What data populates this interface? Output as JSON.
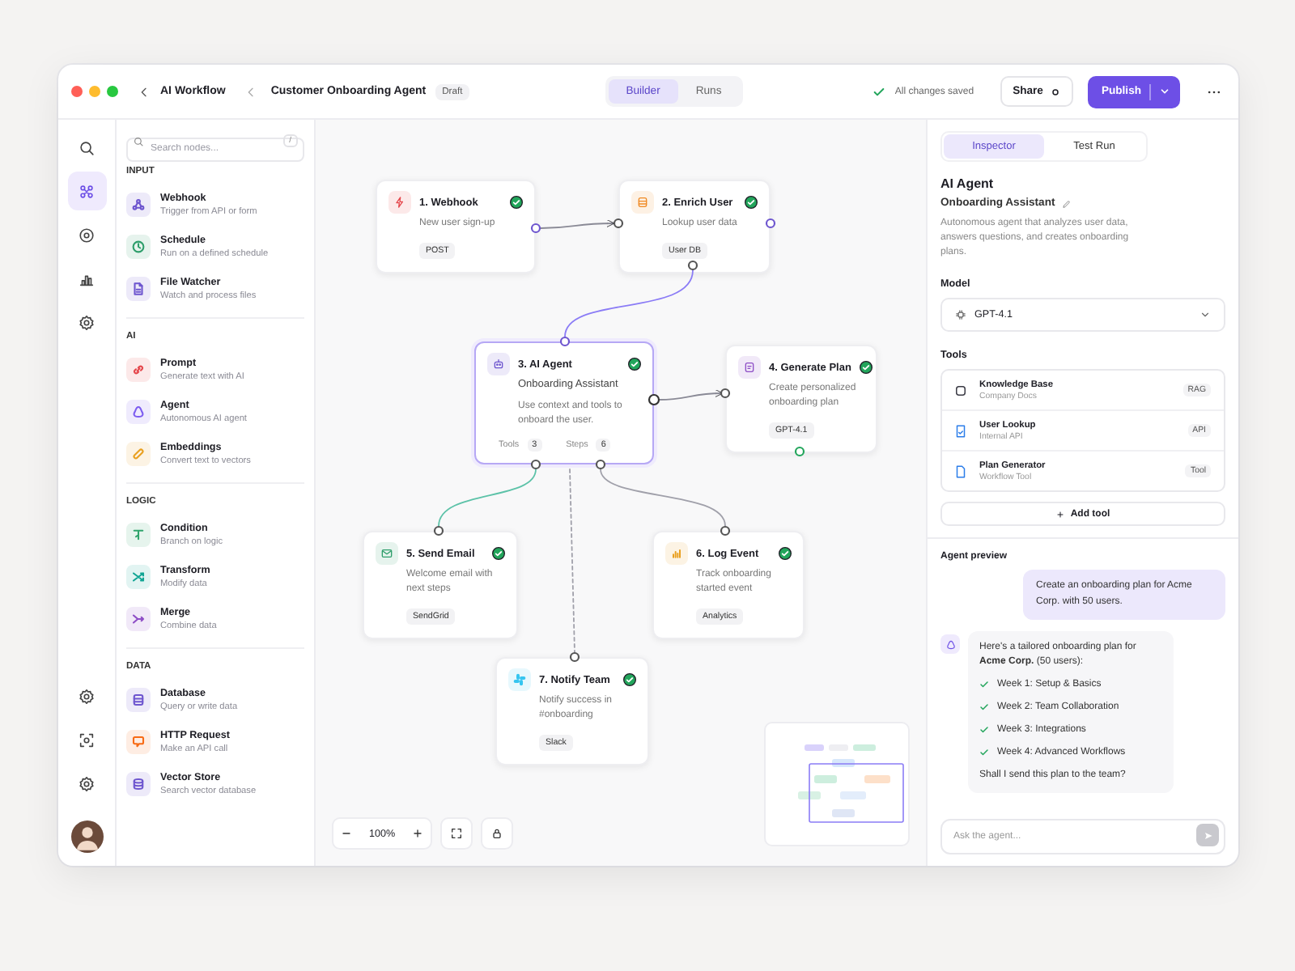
{
  "window": {
    "breadcrumb": "AI Workflow",
    "title": "Customer Onboarding Agent",
    "badge": "Draft"
  },
  "view_tabs": [
    {
      "label": "Builder",
      "selected": true
    },
    {
      "label": "Runs",
      "selected": false
    }
  ],
  "save_status": "All changes saved",
  "share_label": "Share",
  "publish_label": "Publish",
  "rail": {
    "top": [
      {
        "kind": "search",
        "selected": false
      },
      {
        "kind": "nodes",
        "selected": true
      },
      {
        "kind": "target",
        "selected": false
      },
      {
        "kind": "chart",
        "selected": false
      },
      {
        "kind": "gear",
        "selected": false
      }
    ],
    "bottom": [
      {
        "kind": "gear",
        "selected": false
      },
      {
        "kind": "scan",
        "selected": false
      },
      {
        "kind": "gear",
        "selected": false
      }
    ]
  },
  "node_panel": {
    "search_placeholder": "Search nodes...",
    "shortcut": "/",
    "sections": [
      {
        "title": "INPUT",
        "items": [
          {
            "name": "Webhook",
            "description": "Trigger from API or form",
            "kind": "webhook",
            "color": "#6e56cf"
          },
          {
            "name": "Schedule",
            "description": "Run on a defined schedule",
            "kind": "clock",
            "color": "#2f9e6b"
          },
          {
            "name": "File Watcher",
            "description": "Watch and process files",
            "kind": "file",
            "color": "#6e56cf"
          }
        ]
      },
      {
        "title": "AI",
        "items": [
          {
            "name": "Prompt",
            "description": "Generate text with AI",
            "kind": "link",
            "color": "#e5484d"
          },
          {
            "name": "Agent",
            "description": "Autonomous AI agent",
            "kind": "agent",
            "color": "#7c5cf0"
          },
          {
            "name": "Embeddings",
            "description": "Convert text to vectors",
            "kind": "capsule",
            "color": "#e9a020"
          }
        ]
      },
      {
        "title": "LOGIC",
        "items": [
          {
            "name": "Condition",
            "description": "Branch on logic",
            "kind": "condition",
            "color": "#30a46c"
          },
          {
            "name": "Transform",
            "description": "Modify data",
            "kind": "shuffle",
            "color": "#12a594"
          },
          {
            "name": "Merge",
            "description": "Combine data",
            "kind": "merge",
            "color": "#8e4ec6"
          }
        ]
      },
      {
        "title": "DATA",
        "items": [
          {
            "name": "Database",
            "description": "Query or write data",
            "kind": "database",
            "color": "#6e56cf"
          },
          {
            "name": "HTTP Request",
            "description": "Make an API call",
            "kind": "message",
            "color": "#f76b15"
          },
          {
            "name": "Vector Store",
            "description": "Search vector database",
            "kind": "layers",
            "color": "#6e56cf"
          }
        ]
      }
    ]
  },
  "canvas": {
    "nodes": [
      {
        "title": "1. Webhook",
        "description": "New user sign-up",
        "tag": "POST",
        "kind": "bolt",
        "color": "#e5484d",
        "done": true,
        "selected": false
      },
      {
        "title": "2. Enrich User",
        "description": "Lookup user data",
        "tag": "User DB",
        "kind": "database",
        "color": "#f08a24",
        "done": true,
        "selected": false
      },
      {
        "title": "3. AI Agent",
        "subtitle": "Onboarding Assistant",
        "description": "Use context and tools to onboard the user.",
        "stats": [
          {
            "label": "Tools",
            "value": "3"
          },
          {
            "label": "Steps",
            "value": "6"
          }
        ],
        "kind": "robot",
        "color": "#6e56cf",
        "done": true,
        "selected": true
      },
      {
        "title": "4. Generate Plan",
        "description": "Create personalized onboarding plan",
        "tag": "GPT-4.1",
        "kind": "plan",
        "color": "#8e4ec6",
        "done": true,
        "selected": false
      },
      {
        "title": "5. Send Email",
        "description": "Welcome email with next steps",
        "tag": "SendGrid",
        "kind": "mail",
        "color": "#2f9e6b",
        "done": true,
        "selected": false
      },
      {
        "title": "6. Log Event",
        "description": "Track onboarding started event",
        "tag": "Analytics",
        "kind": "bars",
        "color": "#e9a020",
        "done": true,
        "selected": false
      },
      {
        "title": "7. Notify Team",
        "description": "Notify success in #onboarding",
        "tag": "Slack",
        "kind": "slack",
        "color": "#36c5f0",
        "done": true,
        "selected": false
      }
    ],
    "zoom": "100%"
  },
  "inspector": {
    "tabs": [
      {
        "label": "Inspector",
        "selected": true
      },
      {
        "label": "Test Run",
        "selected": false
      }
    ],
    "heading": "AI Agent",
    "name": "Onboarding Assistant",
    "description": "Autonomous agent that analyzes user data, answers questions, and creates onboarding plans.",
    "model_label": "Model",
    "model": "GPT-4.1",
    "tools_label": "Tools",
    "tools": [
      {
        "name": "Knowledge Base",
        "description": "Company Docs",
        "badge": "RAG",
        "kind": "square",
        "color": "#3a3a44"
      },
      {
        "name": "User Lookup",
        "description": "Internal API",
        "badge": "API",
        "kind": "userdoc",
        "color": "#2b7de9"
      },
      {
        "name": "Plan Generator",
        "description": "Workflow Tool",
        "badge": "Tool",
        "kind": "doc",
        "color": "#2b7de9"
      }
    ],
    "add_tool": "Add tool",
    "preview_label": "Agent preview",
    "messages": [
      {
        "kind": "user",
        "text": "Create an onboarding plan for Acme Corp. with 50 users."
      },
      {
        "kind": "agent",
        "text": "Here's a tailored onboarding plan for **Acme Corp.** (50 users):",
        "steps": [
          "Week 1: Setup & Basics",
          "Week 2: Team Collaboration",
          "Week 3: Integrations",
          "Week 4: Advanced Workflows"
        ],
        "closing": "Shall I send this plan to the team?"
      }
    ],
    "input_placeholder": "Ask the agent..."
  }
}
